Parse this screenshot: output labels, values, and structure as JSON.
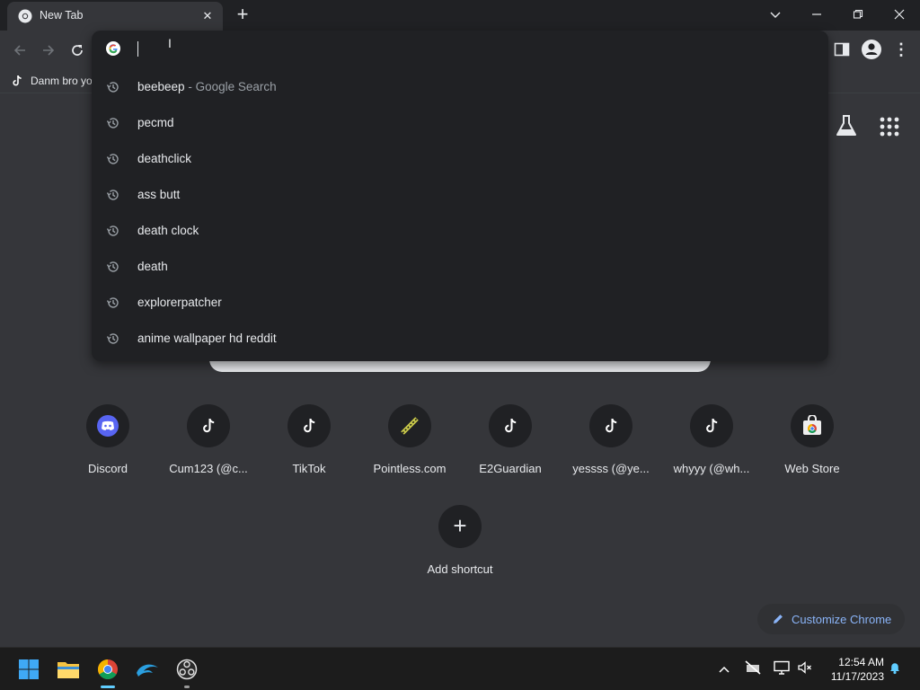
{
  "window": {
    "tab_title": "New Tab",
    "new_tab_symbol": "+",
    "tab_close_symbol": "✕"
  },
  "omnibox": {
    "input_value": "",
    "suggestions": [
      {
        "text": "beebeep",
        "description": "- Google Search",
        "icon": "search-history-icon"
      },
      {
        "text": "pecmd",
        "description": "",
        "icon": "history-icon"
      },
      {
        "text": "deathclick",
        "description": "",
        "icon": "history-icon"
      },
      {
        "text": "ass butt",
        "description": "",
        "icon": "history-icon"
      },
      {
        "text": "death clock",
        "description": "",
        "icon": "history-icon"
      },
      {
        "text": "death",
        "description": "",
        "icon": "history-icon"
      },
      {
        "text": "explorerpatcher",
        "description": "",
        "icon": "history-icon"
      },
      {
        "text": "anime wallpaper hd reddit",
        "description": "",
        "icon": "history-icon"
      }
    ]
  },
  "bookmarks": [
    {
      "label": "Danm bro yo",
      "icon": "tiktok-icon"
    }
  ],
  "shortcuts": [
    {
      "label": "Discord",
      "icon": "discord-icon"
    },
    {
      "label": "Cum123 (@c...",
      "icon": "tiktok-icon"
    },
    {
      "label": "TikTok",
      "icon": "tiktok-icon"
    },
    {
      "label": "Pointless.com",
      "icon": "pointless-icon"
    },
    {
      "label": "E2Guardian",
      "icon": "tiktok-icon"
    },
    {
      "label": "yessss (@ye...",
      "icon": "tiktok-icon"
    },
    {
      "label": "whyyy (@wh...",
      "icon": "tiktok-icon"
    },
    {
      "label": "Web Store",
      "icon": "web-store-icon"
    }
  ],
  "add_shortcut": {
    "label": "Add shortcut",
    "symbol": "+"
  },
  "customize": {
    "label": "Customize Chrome"
  },
  "taskbar": {
    "apps": [
      "windows-start-icon",
      "file-explorer-icon",
      "chrome-icon",
      "dolphin-icon",
      "obs-icon"
    ],
    "time": "12:54 AM",
    "date": "11/17/2023"
  },
  "colors": {
    "background": "#35363a",
    "omnibox": "#202124",
    "accent": "#8ab4f8",
    "taskbar": "#1c1c1c"
  }
}
